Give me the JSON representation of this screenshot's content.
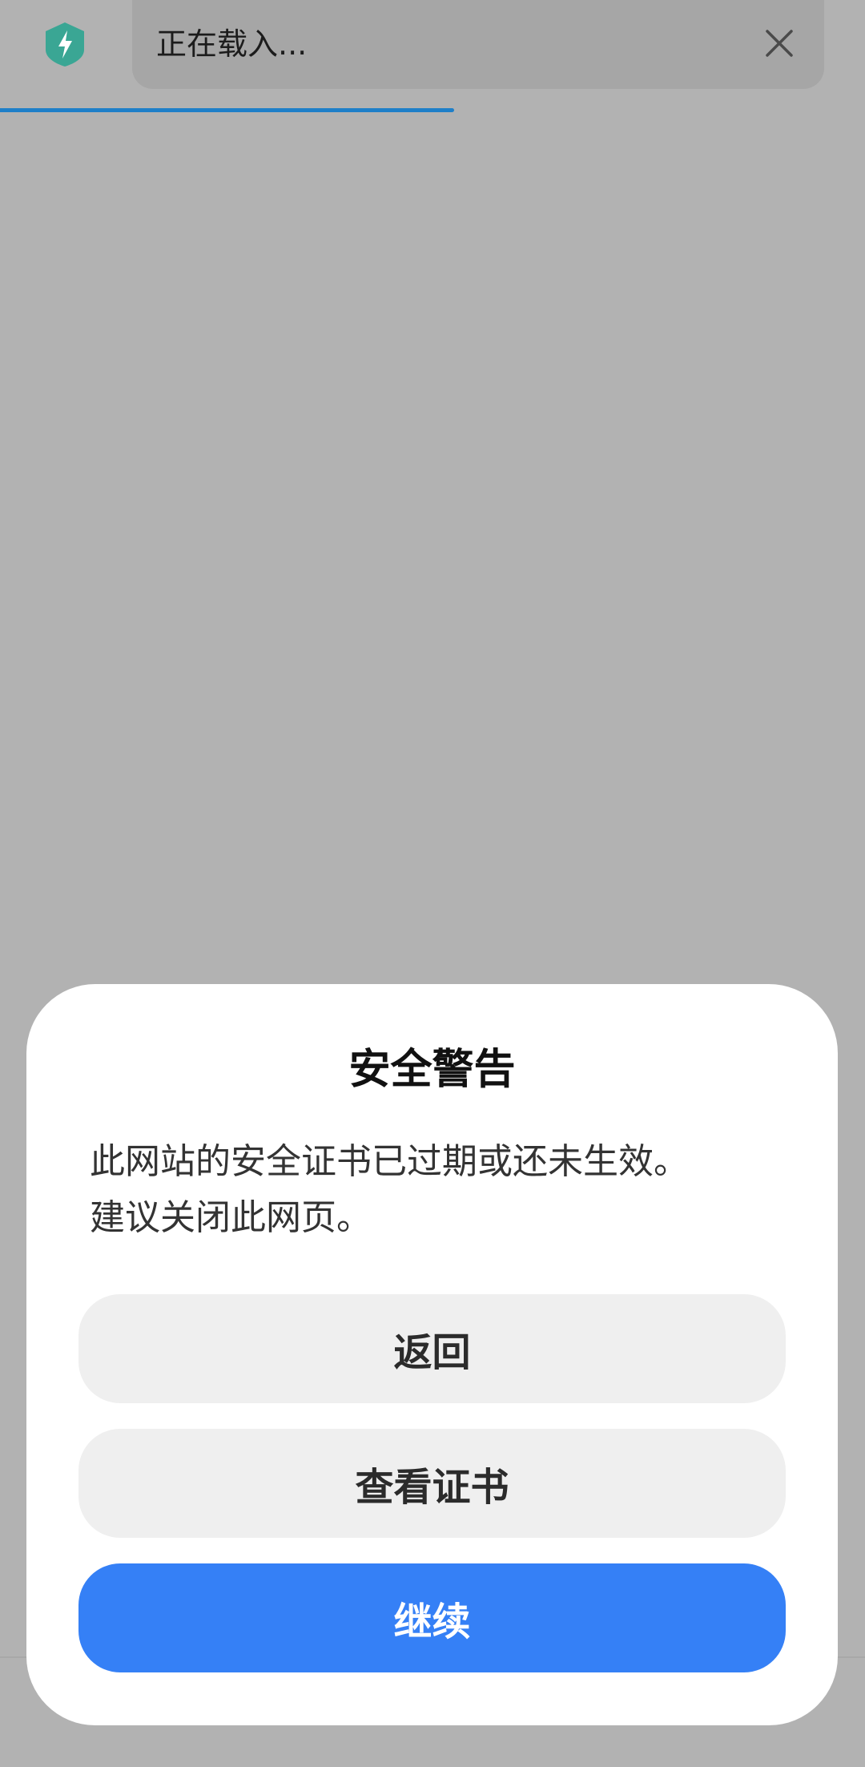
{
  "toolbar": {
    "url_text": "正在载入...",
    "loading_progress_percent": 52.5,
    "accent_color": "#1e7fc8",
    "shield_color": "#3aa694",
    "shield_icon": "shield-bolt-icon",
    "close_icon": "close-icon"
  },
  "dialog": {
    "title": "安全警告",
    "message_lines": [
      "此网站的安全证书已过期或还未生效。",
      "建议关闭此网页。"
    ],
    "buttons": {
      "back_label": "返回",
      "view_certificate_label": "查看证书",
      "continue_label": "继续"
    },
    "primary_color": "#3580f6"
  }
}
